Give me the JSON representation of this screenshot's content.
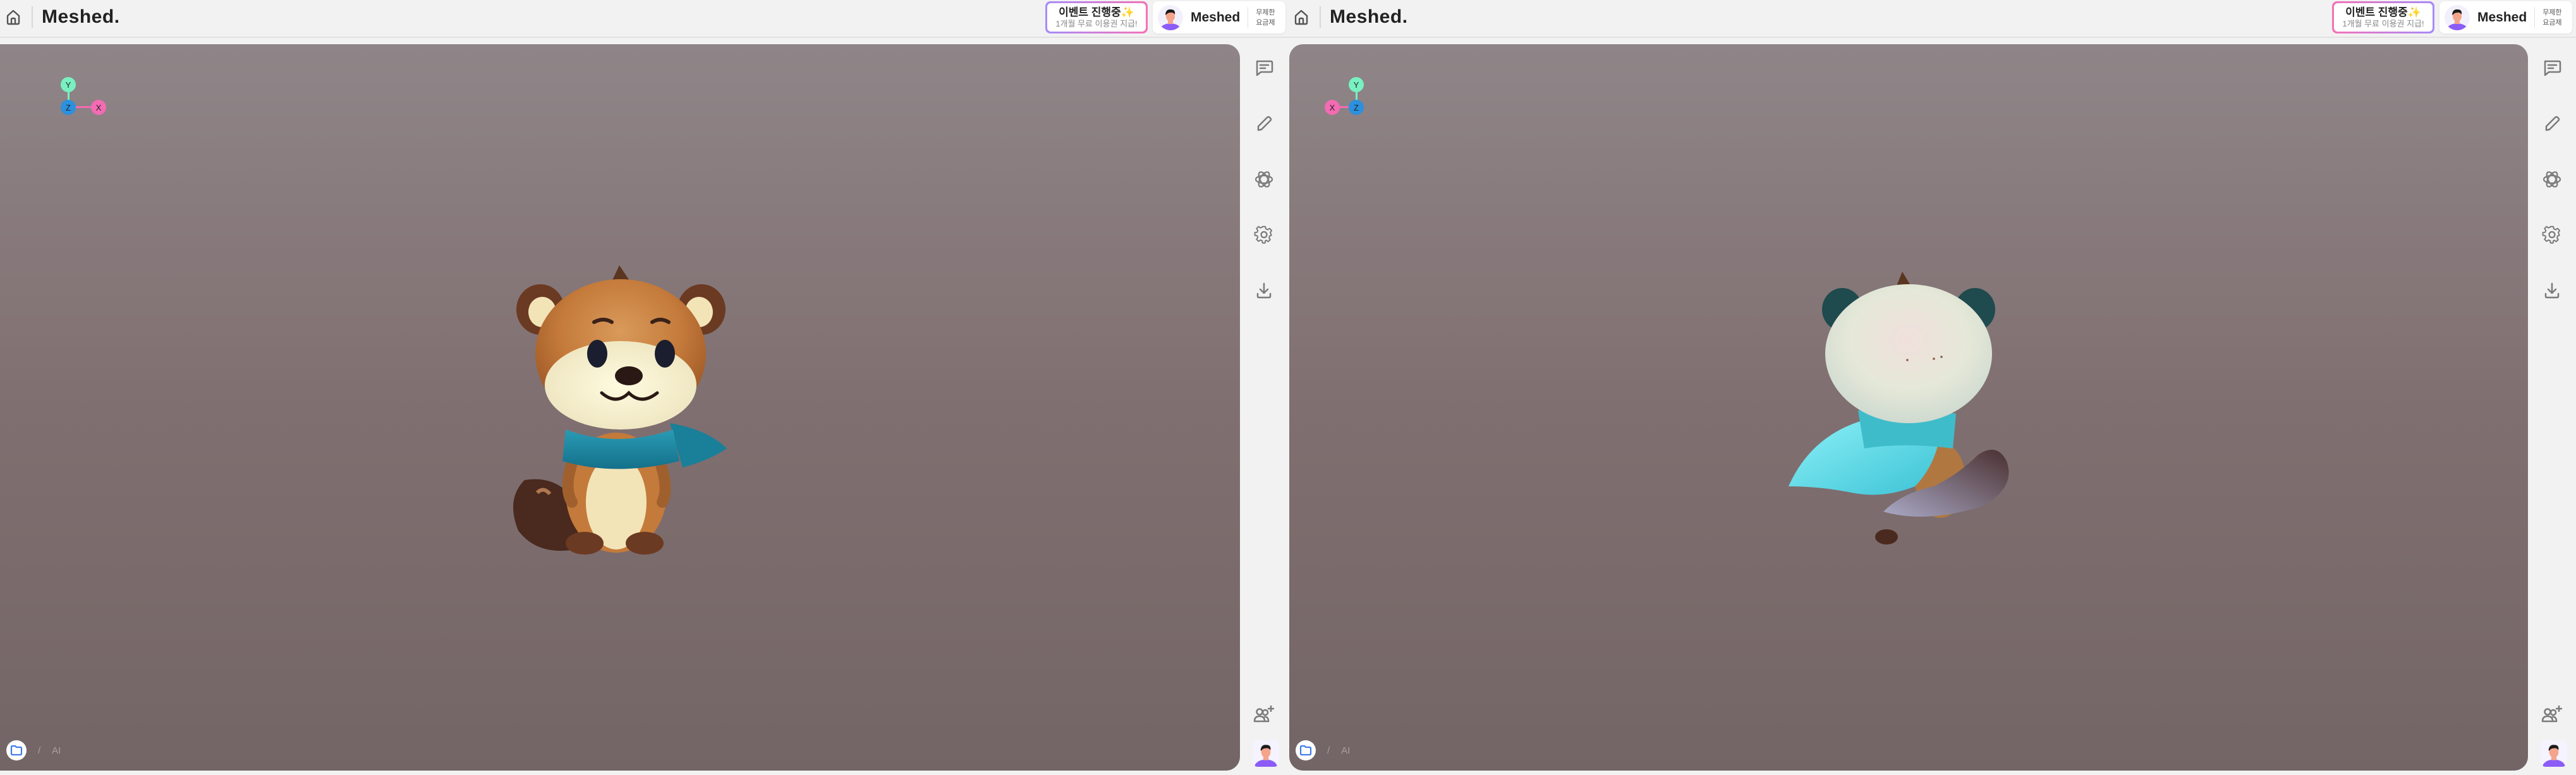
{
  "panes": [
    {
      "header": {
        "logo": "Meshed.",
        "event_title": "이벤트 진행중✨",
        "event_sub": "1개월 무료 이용권 지급!",
        "profile_name": "Meshed",
        "plan_line1": "무제한",
        "plan_line2": "요금제"
      },
      "axes": {
        "x": "X",
        "y": "Y",
        "z": "Z"
      },
      "model_view": "front",
      "breadcrumb": {
        "separator": "/",
        "item": "AI"
      }
    },
    {
      "header": {
        "logo": "Meshed.",
        "event_title": "이벤트 진행중✨",
        "event_sub": "1개월 무료 이용권 지급!",
        "profile_name": "Meshed",
        "plan_line1": "무제한",
        "plan_line2": "요금제"
      },
      "axes": {
        "x": "X",
        "y": "Y",
        "z": "Z"
      },
      "model_view": "back",
      "breadcrumb": {
        "separator": "/",
        "item": "AI"
      }
    }
  ],
  "toolbar": {
    "icons": [
      "comment-icon",
      "pencil-icon",
      "atom-icon",
      "gear-icon",
      "download-icon",
      "add-user-icon"
    ]
  },
  "colors": {
    "axis_x": "#f36bb3",
    "axis_y": "#78f0c0",
    "axis_z": "#2b90de",
    "icon_gray": "#7a7a7a",
    "folder_blue": "#3d7be8"
  }
}
